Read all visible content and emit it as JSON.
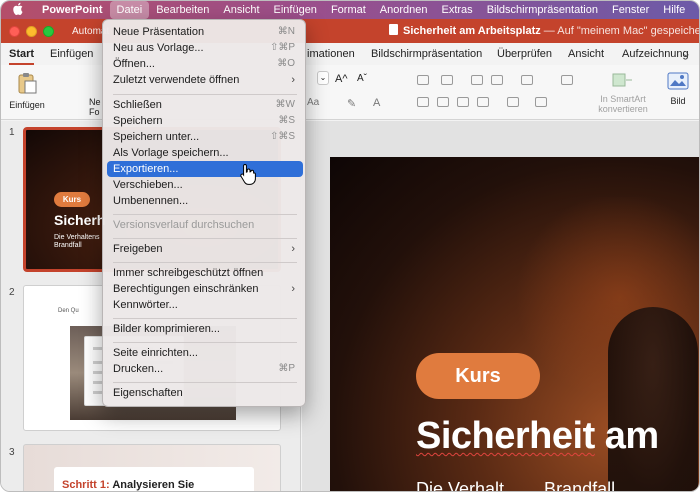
{
  "menubar": {
    "apple_icon": "apple-logo-icon",
    "items": [
      "PowerPoint",
      "Datei",
      "Bearbeiten",
      "Ansicht",
      "Einfügen",
      "Format",
      "Anordnen",
      "Extras",
      "Bildschirmpräsentation",
      "Fenster",
      "Hilfe"
    ]
  },
  "titlebar": {
    "autosave": "Automat",
    "doc_title": "Sicherheit am Arbeitsplatz",
    "doc_subtitle": " — Auf \"meinem Mac\" gespeichert",
    "doc_subtitle_chevron": "⌄"
  },
  "ribbon_tabs": {
    "start": "Start",
    "einfuegen": "Einfügen",
    "animationen": "imationen",
    "bildschirm": "Bildschirmpräsentation",
    "ueberpruefen": "Überprüfen",
    "ansicht": "Ansicht",
    "aufzeichnung": "Aufzeichnung",
    "more": "⌄"
  },
  "ribbon": {
    "paste_label": "Einfügen",
    "new_label_1": "Ne",
    "new_label_2": "Fo",
    "font_grow": "A^",
    "font_shrink": "Aˇ",
    "font_effects": "Aa",
    "smartart_line1": "In SmartArt",
    "smartart_line2": "konvertieren",
    "bild_label": "Bild"
  },
  "thumbnails": {
    "n1": "1",
    "n2": "2",
    "n3": "3",
    "s1_badge": "Kurs",
    "s1_title": "Sicherh",
    "s1_sub1": "Die Verhaltens",
    "s1_sub2": "Brandfall",
    "s2_head": "Den Qu",
    "s3_prefix": "Schritt 1:",
    "s3_text": " Analysieren Sie"
  },
  "slide": {
    "badge": "Kurs",
    "title_a": "Sicherheit",
    "title_b": " am",
    "subtitle": "Die Verhalt  ......  Brandfall"
  },
  "menu": {
    "items": [
      {
        "label": "Neue Präsentation",
        "shortcut": "⌘N"
      },
      {
        "label": "Neu aus Vorlage...",
        "shortcut": "⇧⌘P"
      },
      {
        "label": "Öffnen...",
        "shortcut": "⌘O"
      },
      {
        "label": "Zuletzt verwendete öffnen",
        "arrow": "›"
      },
      {
        "label": "Schließen",
        "shortcut": "⌘W"
      },
      {
        "label": "Speichern",
        "shortcut": "⌘S"
      },
      {
        "label": "Speichern unter...",
        "shortcut": "⇧⌘S"
      },
      {
        "label": "Als Vorlage speichern..."
      },
      {
        "label": "Exportieren..."
      },
      {
        "label": "Verschieben..."
      },
      {
        "label": "Umbenennen..."
      },
      {
        "label": "Versionsverlauf durchsuchen"
      },
      {
        "label": "Freigeben",
        "arrow": "›"
      },
      {
        "label": "Immer schreibgeschützt öffnen"
      },
      {
        "label": "Berechtigungen einschränken",
        "arrow": "›"
      },
      {
        "label": "Kennwörter..."
      },
      {
        "label": "Bilder komprimieren..."
      },
      {
        "label": "Seite einrichten..."
      },
      {
        "label": "Drucken...",
        "shortcut": "⌘P"
      },
      {
        "label": "Eigenschaften"
      }
    ]
  },
  "colors": {
    "accent": "#c4432c",
    "highlight": "#2f6fd8",
    "badge": "#e07b3e"
  }
}
